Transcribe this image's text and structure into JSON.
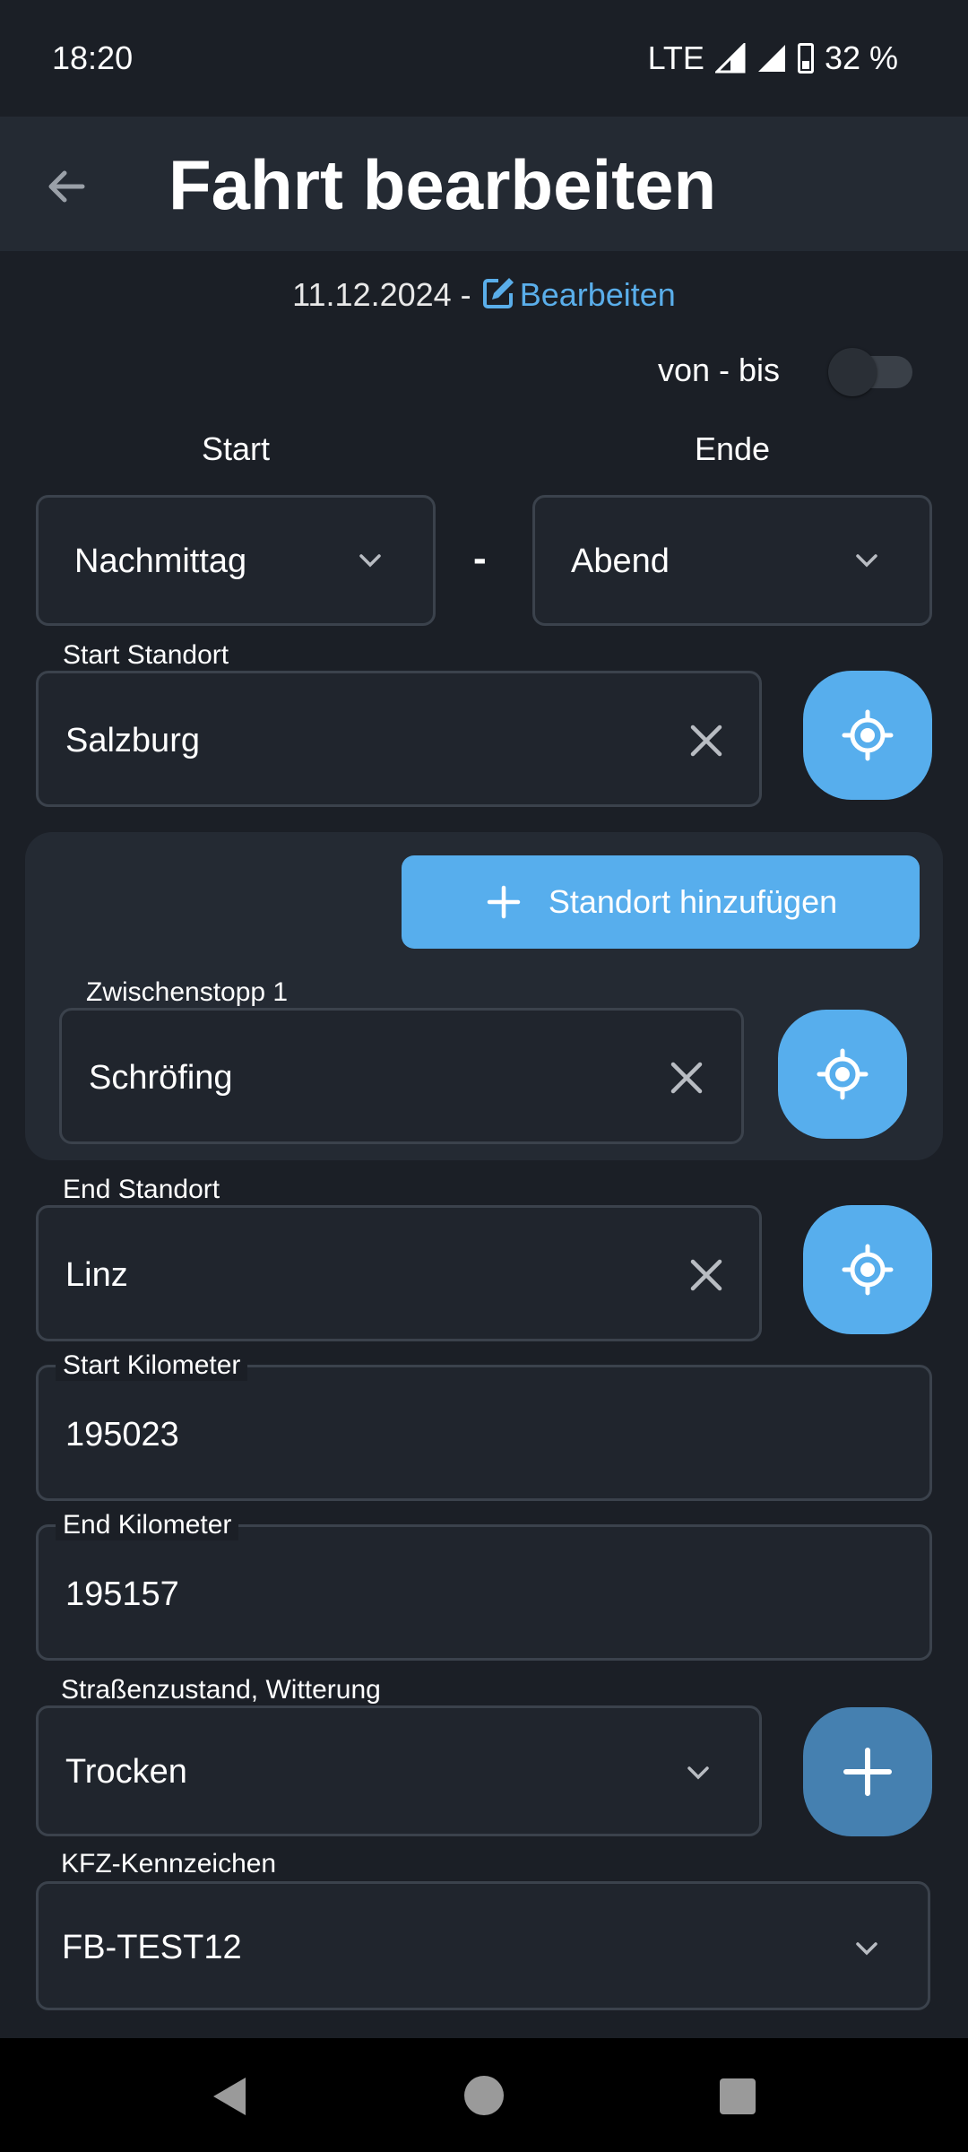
{
  "status_bar": {
    "time": "18:20",
    "network": "LTE",
    "battery": "32 %"
  },
  "app_bar": {
    "title": "Fahrt bearbeiten",
    "back_icon": "arrow-left-icon"
  },
  "date_row": {
    "date": "11.12.2024 -",
    "edit_label": "Bearbeiten",
    "edit_icon": "pencil-square-icon"
  },
  "range_toggle": {
    "label": "von - bis",
    "enabled": false
  },
  "time_range": {
    "start_header": "Start",
    "end_header": "Ende",
    "separator": "-",
    "start_value": "Nachmittag",
    "end_value": "Abend"
  },
  "start_location": {
    "label": "Start Standort",
    "value": "Salzburg"
  },
  "stops": {
    "add_label": "Standort hinzufügen",
    "items": [
      {
        "label": "Zwischenstopp 1",
        "value": "Schröfing"
      }
    ]
  },
  "end_location": {
    "label": "End Standort",
    "value": "Linz"
  },
  "start_km": {
    "label": "Start Kilometer",
    "value": "195023"
  },
  "end_km": {
    "label": "End Kilometer",
    "value": "195157"
  },
  "road_condition": {
    "label": "Straßenzustand, Witterung",
    "value": "Trocken"
  },
  "license_plate": {
    "label": "KFZ-Kennzeichen",
    "value": "FB-TEST12"
  },
  "colors": {
    "accent": "#57aeed",
    "background": "#1b1f26",
    "appbar": "#242a33",
    "add_button": "#4580b0"
  }
}
